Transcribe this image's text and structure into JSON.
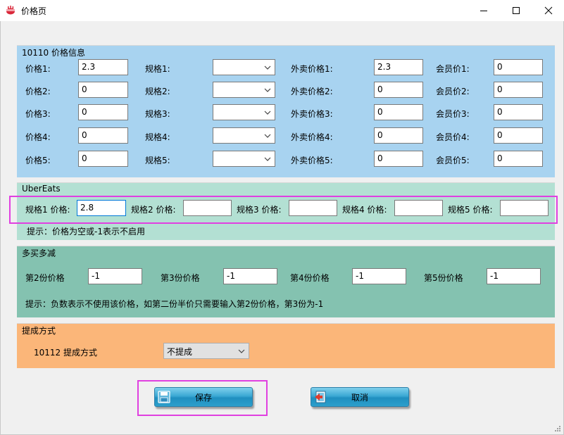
{
  "window": {
    "title": "价格页"
  },
  "price_info": {
    "title": "10110 价格信息",
    "rows": [
      {
        "price_label": "价格1:",
        "price": "2.3",
        "spec_label": "规格1:",
        "spec": "",
        "takeout_label": "外卖价格1:",
        "takeout": "2.3",
        "member_label": "会员价1:",
        "member": "0"
      },
      {
        "price_label": "价格2:",
        "price": "0",
        "spec_label": "规格2:",
        "spec": "",
        "takeout_label": "外卖价格2:",
        "takeout": "0",
        "member_label": "会员价2:",
        "member": "0"
      },
      {
        "price_label": "价格3:",
        "price": "0",
        "spec_label": "规格3:",
        "spec": "",
        "takeout_label": "外卖价格3:",
        "takeout": "0",
        "member_label": "会员价3:",
        "member": "0"
      },
      {
        "price_label": "价格4:",
        "price": "0",
        "spec_label": "规格4:",
        "spec": "",
        "takeout_label": "外卖价格4:",
        "takeout": "0",
        "member_label": "会员价4:",
        "member": "0"
      },
      {
        "price_label": "价格5:",
        "price": "0",
        "spec_label": "规格5:",
        "spec": "",
        "takeout_label": "外卖价格5:",
        "takeout": "0",
        "member_label": "会员价5:",
        "member": "0"
      }
    ]
  },
  "ubereats": {
    "title": "UberEats",
    "fields": [
      {
        "label": "规格1 价格:",
        "value": "2.8"
      },
      {
        "label": "规格2 价格:",
        "value": ""
      },
      {
        "label": "规格3 价格:",
        "value": ""
      },
      {
        "label": "规格4 价格:",
        "value": ""
      },
      {
        "label": "规格5 价格:",
        "value": ""
      }
    ],
    "hint": "提示：价格为空或-1表示不启用"
  },
  "multi_buy": {
    "title": "多买多减",
    "fields": [
      {
        "label": "第2份价格",
        "value": "-1"
      },
      {
        "label": "第3份价格",
        "value": "-1"
      },
      {
        "label": "第4份价格",
        "value": "-1"
      },
      {
        "label": "第5份价格",
        "value": "-1"
      }
    ],
    "hint": "提示：负数表示不使用该价格，如第二份半价只需要输入第2份价格，第3份为-1"
  },
  "commission": {
    "title": "提成方式",
    "label": "10112 提成方式",
    "selected": "不提成"
  },
  "buttons": {
    "save": "保存",
    "cancel": "取消"
  },
  "colors": {
    "price_panel": "#a8d3f0",
    "ubereats_panel": "#b3e0d3",
    "multibuy_panel": "#84c2b0",
    "commission_panel": "#fbb679",
    "highlight": "#e040e0",
    "button_blue": "#3aa8d4"
  }
}
